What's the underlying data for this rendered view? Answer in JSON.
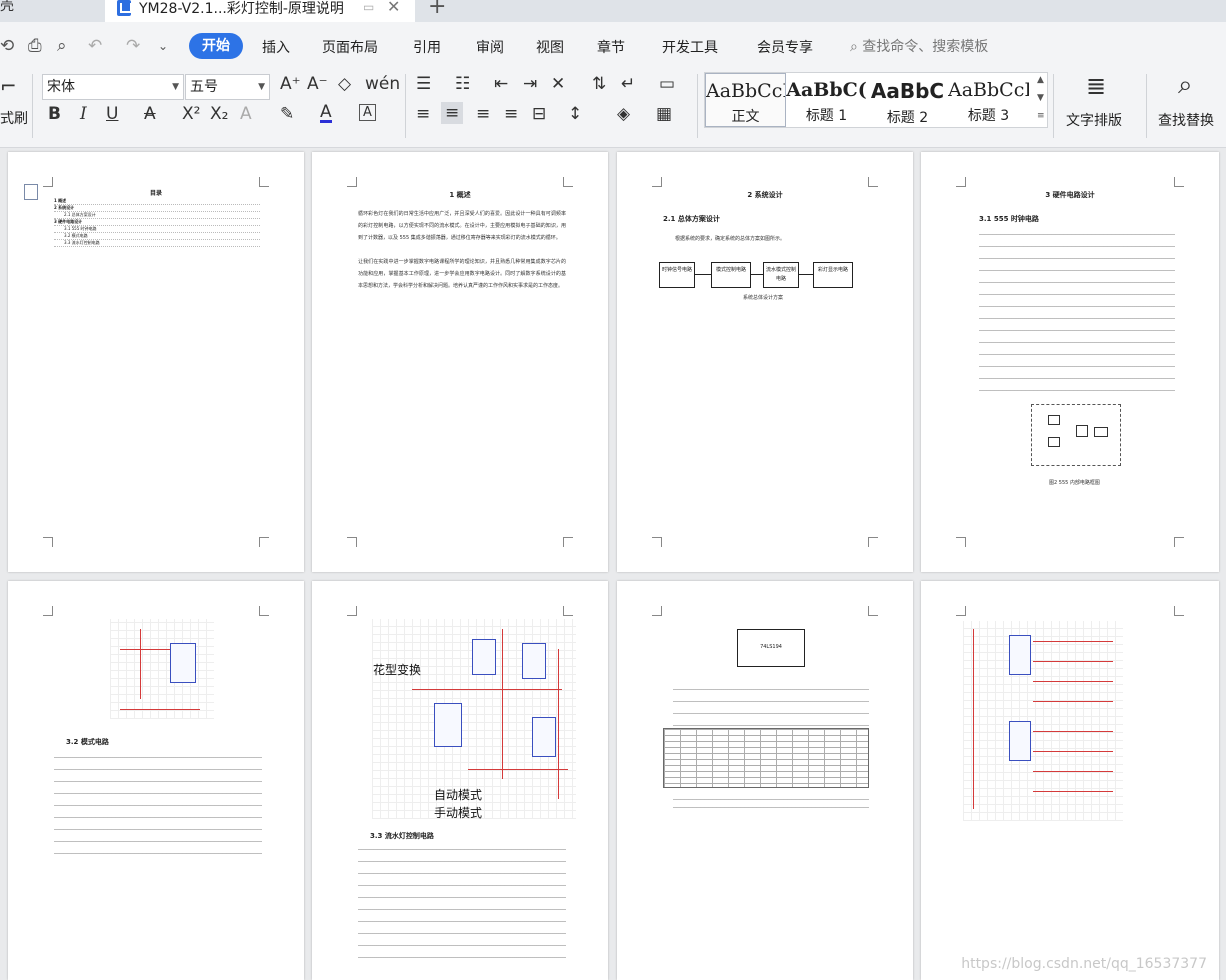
{
  "tabbar": {
    "prev_tab": "壳",
    "doc_title": "YM28-V2.1...彩灯控制-原理说明",
    "close": "✕",
    "new_tab": "+"
  },
  "menubar": {
    "active": "开始",
    "items": [
      "插入",
      "页面布局",
      "引用",
      "审阅",
      "视图",
      "章节",
      "开发工具",
      "会员专享"
    ],
    "search": "查找命令、搜索模板"
  },
  "toolbar": {
    "format_brush": "式刷",
    "font": "宋体",
    "size": "五号",
    "styles": [
      {
        "sample": "AaBbCcI",
        "label": "正文"
      },
      {
        "sample": "AaBbC(",
        "label": "标题 1"
      },
      {
        "sample": "AaBbC",
        "label": "标题 2"
      },
      {
        "sample": "AaBbCcI",
        "label": "标题 3"
      }
    ],
    "text_layout": "文字排版",
    "find_replace": "查找替换"
  },
  "pages": {
    "p1": {
      "title": "目录",
      "toc": [
        "1 概述",
        "2 系统设计",
        "2.1 总体方案设计",
        "3 硬件电路设计",
        "3.1 555 时钟电路",
        "3.2 模式电路",
        "3.3 流水灯控制电路"
      ]
    },
    "p2": {
      "heading": "1 概述",
      "body": "循环彩色灯在我们的日常生活中应用广泛，并且深受人们的喜爱。因此设计一种具有可调频率的彩灯控制电路，以方便实现不同的流水模式。在设计中，主要应用模拟电子基础的知识，用到了计数器，以及 555 集成多谐振荡器，通过移位寄存器等来实现彩灯的流水模式的循环。",
      "body2": "让我们在实践中进一步掌握数字电路课程所学的理论知识，并且熟悉几种常用集成数字芯片的功能和应用，掌握基本工作原理，进一步学会应用数字电路设计。同时了解数字系统设计的基本思想和方法，学会科学分析和解决问题。培养认真严谨的工作作风和实事求是的工作态度。"
    },
    "p3": {
      "heading": "2 系统设计",
      "sub": "2.1 总体方案设计",
      "intro": "根据系统的要求，确定系统的总体方案如图所示。",
      "blocks": [
        "时钟信号电路",
        "模式控制电路",
        "流水模式控制电路",
        "彩灯显示电路"
      ],
      "caption": "系统总体设计方案"
    },
    "p4": {
      "heading": "3 硬件电路设计",
      "sub": "3.1 555 时钟电路",
      "caption": "图2 555 内部电路框图"
    },
    "p5": {
      "sub": "3.2 模式电路"
    },
    "p6": {
      "label1": "花型变换",
      "label2": "自动模式",
      "label3": "手动模式",
      "sub": "3.3 流水灯控制电路"
    },
    "p7": {
      "chip": "74LS194"
    },
    "p8": {}
  },
  "watermark": "https://blog.csdn.net/qq_16537377"
}
